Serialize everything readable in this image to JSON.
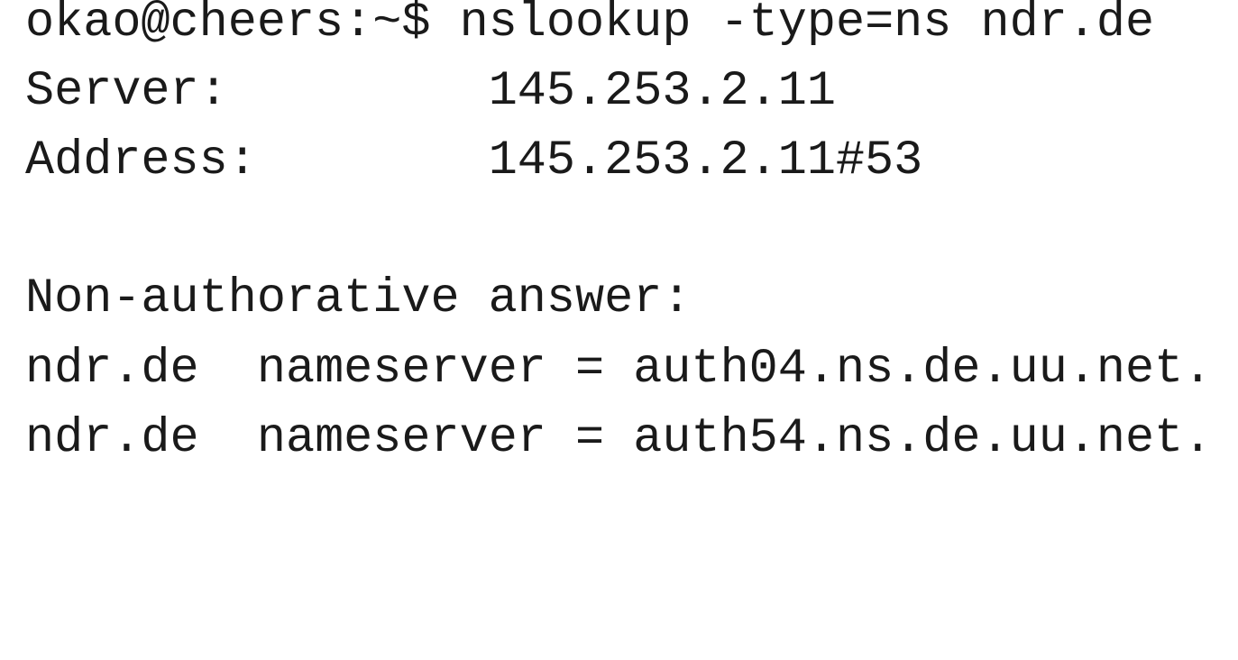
{
  "terminal": {
    "prompt": "okao@cheers:~$",
    "command": "nslookup -type=ns ndr.de",
    "server_label": "Server:",
    "server_value": "145.253.2.11",
    "address_label": "Address:",
    "address_value": "145.253.2.11#53",
    "answer_header": "Non-authorative answer:",
    "records": [
      {
        "domain": "ndr.de",
        "type": "nameserver",
        "eq": "=",
        "value": "auth04.ns.de.uu.net."
      },
      {
        "domain": "ndr.de",
        "type": "nameserver",
        "eq": "=",
        "value": "auth54.ns.de.uu.net."
      }
    ]
  }
}
